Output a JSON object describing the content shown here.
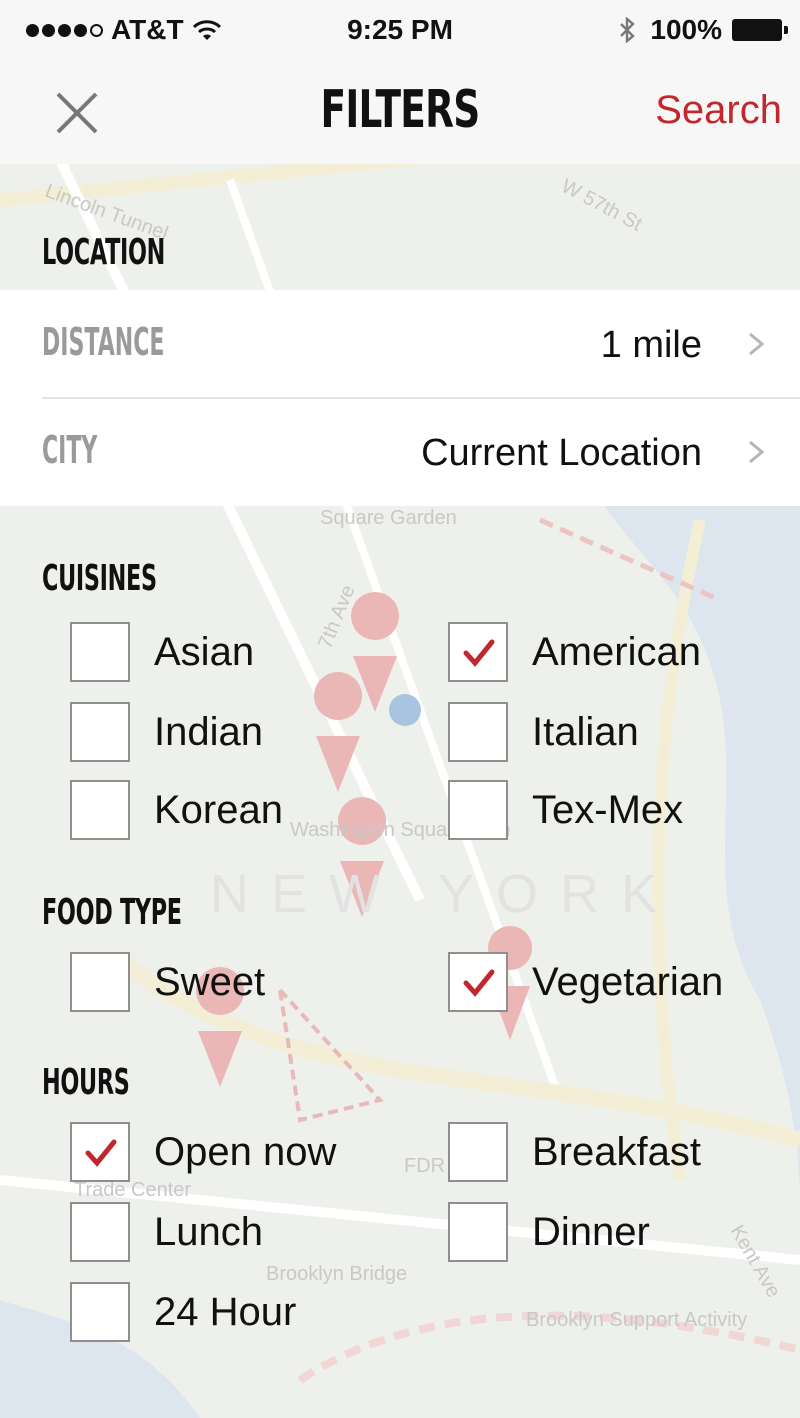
{
  "status_bar": {
    "carrier": "AT&T",
    "time": "9:25 PM",
    "battery": "100%"
  },
  "nav": {
    "title": "FILTERS",
    "search_label": "Search",
    "close_icon": "close-icon"
  },
  "location": {
    "heading": "LOCATION",
    "distance": {
      "label": "DISTANCE",
      "value": "1 mile"
    },
    "city": {
      "label": "CITY",
      "value": "Current Location"
    }
  },
  "cuisines": {
    "heading": "CUISINES",
    "options": [
      {
        "label": "Asian",
        "checked": false
      },
      {
        "label": "American",
        "checked": true
      },
      {
        "label": "Indian",
        "checked": false
      },
      {
        "label": "Italian",
        "checked": false
      },
      {
        "label": "Korean",
        "checked": false
      },
      {
        "label": "Tex-Mex",
        "checked": false
      }
    ]
  },
  "food_type": {
    "heading": "FOOD TYPE",
    "options": [
      {
        "label": "Sweet",
        "checked": false
      },
      {
        "label": "Vegetarian",
        "checked": true
      }
    ]
  },
  "hours": {
    "heading": "HOURS",
    "options": [
      {
        "label": "Open now",
        "checked": true
      },
      {
        "label": "Breakfast",
        "checked": false
      },
      {
        "label": "Lunch",
        "checked": false
      },
      {
        "label": "Dinner",
        "checked": false
      },
      {
        "label": "24 Hour",
        "checked": false
      }
    ]
  },
  "map_labels": {
    "street_1": "Lincoln Tunnel",
    "street_2": "W 57th St",
    "venue_1": "Square Garden",
    "avenue_1": "7th Ave",
    "landmark_1": "Washington Square Arch",
    "city": "NEW YORK",
    "landmark_2": "Trade Center",
    "landmark_3": "Brooklyn Bridge",
    "landmark_4": "Brooklyn Support Activity",
    "road_1": "FDR",
    "road_2": "Kent Ave"
  },
  "colors": {
    "accent_red": "#c0282d",
    "check_red": "#c0282d",
    "bar_bg": "#f7f7f7",
    "map_bg": "#eef0ec"
  }
}
